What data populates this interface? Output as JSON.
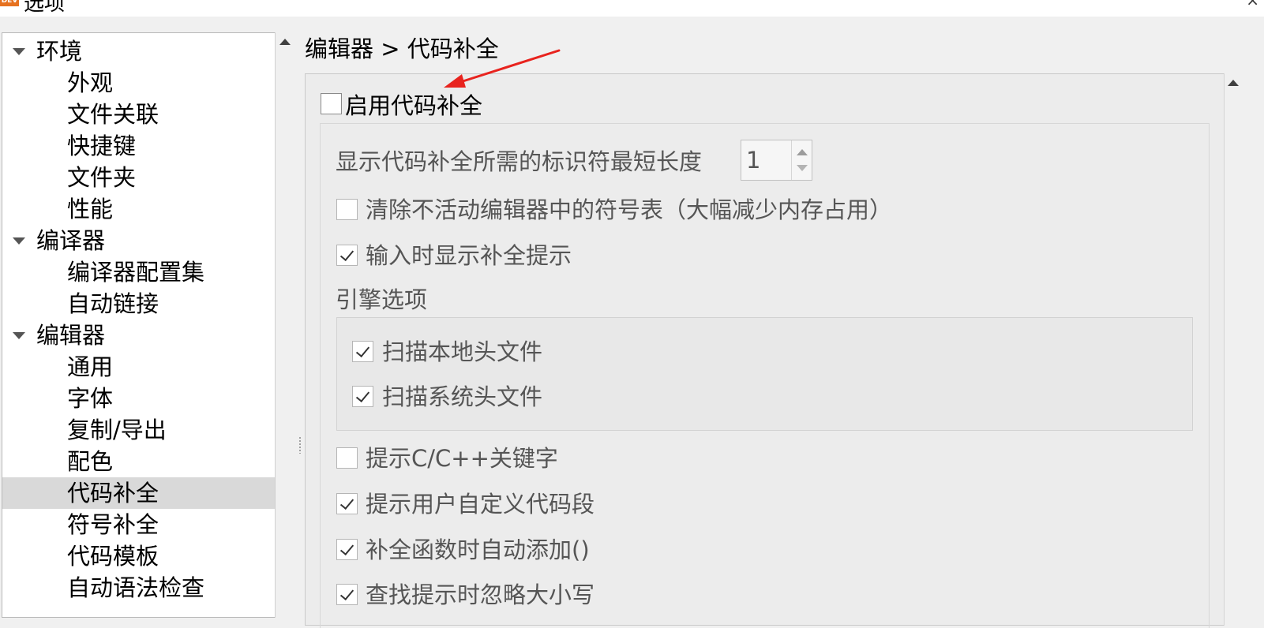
{
  "window": {
    "title": "选项",
    "icon_text": "DEV",
    "title_glyph": "×"
  },
  "tree": {
    "items": [
      {
        "label": "环境",
        "level": 1,
        "expanded": true
      },
      {
        "label": "外观",
        "level": 2
      },
      {
        "label": "文件关联",
        "level": 2
      },
      {
        "label": "快捷键",
        "level": 2
      },
      {
        "label": "文件夹",
        "level": 2
      },
      {
        "label": "性能",
        "level": 2
      },
      {
        "label": "编译器",
        "level": 1,
        "expanded": true
      },
      {
        "label": "编译器配置集",
        "level": 2
      },
      {
        "label": "自动链接",
        "level": 2
      },
      {
        "label": "编辑器",
        "level": 1,
        "expanded": true
      },
      {
        "label": "通用",
        "level": 2
      },
      {
        "label": "字体",
        "level": 2
      },
      {
        "label": "复制/导出",
        "level": 2
      },
      {
        "label": "配色",
        "level": 2
      },
      {
        "label": "代码补全",
        "level": 2,
        "selected": true
      },
      {
        "label": "符号补全",
        "level": 2
      },
      {
        "label": "代码模板",
        "level": 2
      },
      {
        "label": "自动语法检查",
        "level": 2
      }
    ]
  },
  "breadcrumb": "编辑器 > 代码补全",
  "settings": {
    "enable_completion": {
      "label": "启用代码补全",
      "checked": false
    },
    "min_length": {
      "label": "显示代码补全所需的标识符最短长度",
      "value": "1"
    },
    "clear_symbols": {
      "label": "清除不活动编辑器中的符号表（大幅减少内存占用）",
      "checked": false
    },
    "show_on_input": {
      "label": "输入时显示补全提示",
      "checked": true
    },
    "engine_title": "引擎选项",
    "scan_local": {
      "label": "扫描本地头文件",
      "checked": true
    },
    "scan_system": {
      "label": "扫描系统头文件",
      "checked": true
    },
    "show_keywords": {
      "label": "提示C/C++关键字",
      "checked": false
    },
    "show_snippets": {
      "label": "提示用户自定义代码段",
      "checked": true
    },
    "add_parens": {
      "label": "补全函数时自动添加()",
      "checked": true
    },
    "ignore_case": {
      "label": "查找提示时忽略大小写",
      "checked": true
    }
  },
  "colors": {
    "annotation_arrow": "#e8231e",
    "selection": "#d9d9d9",
    "panel": "#ececec"
  }
}
